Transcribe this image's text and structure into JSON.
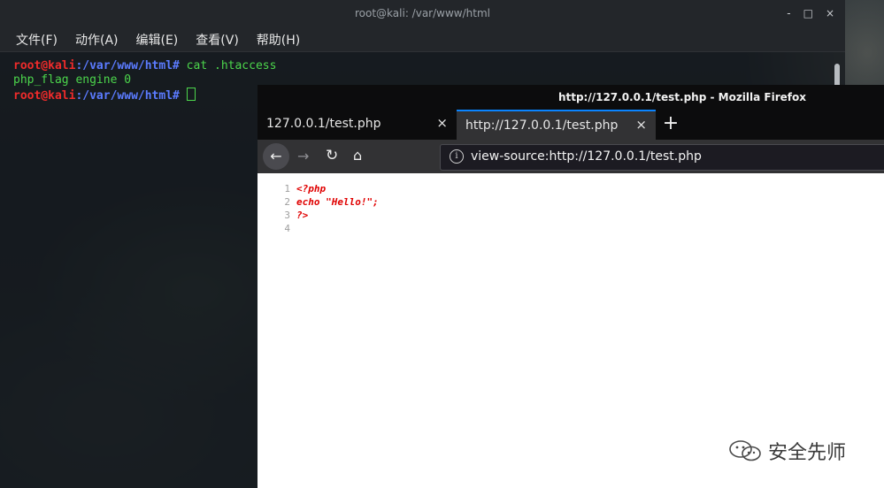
{
  "terminal": {
    "title": "root@kali: /var/www/html",
    "controls": [
      "-",
      "□",
      "×"
    ],
    "menu": [
      "文件(F)",
      "动作(A)",
      "编辑(E)",
      "查看(V)",
      "帮助(H)"
    ],
    "lines": [
      {
        "user": "root@kali",
        "sep": ":",
        "path": "/var/www/html",
        "prompt": "#",
        "cmd": " cat .htaccess"
      },
      {
        "output": "php_flag engine 0"
      },
      {
        "user": "root@kali",
        "sep": ":",
        "path": "/var/www/html",
        "prompt": "#",
        "cmd": " "
      }
    ]
  },
  "firefox": {
    "window_title": "http://127.0.0.1/test.php - Mozilla Firefox",
    "tabs": [
      {
        "label": "127.0.0.1/test.php",
        "close": "×"
      },
      {
        "label": "http://127.0.0.1/test.php",
        "close": "×"
      }
    ],
    "new_tab": "+",
    "url": "view-source:http://127.0.0.1/test.php",
    "source_lines": [
      {
        "n": "1",
        "code": "<?php"
      },
      {
        "n": "2",
        "code": "echo \"Hello!\";"
      },
      {
        "n": "3",
        "code": "?>"
      },
      {
        "n": "4",
        "code": ""
      }
    ]
  },
  "watermark": {
    "text": "安全先师"
  },
  "colors": {
    "accent": "#0a84ff",
    "prompt_user": "#ef2b2b",
    "prompt_path": "#5b7bff",
    "command": "#4cd64c",
    "source_code": "#e00000"
  }
}
